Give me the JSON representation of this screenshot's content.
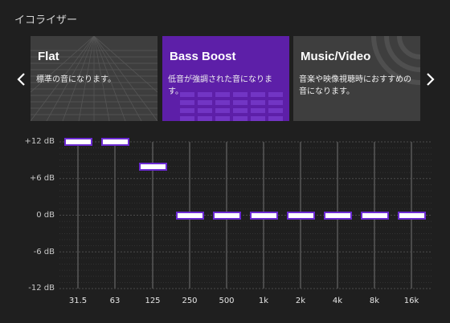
{
  "title": "イコライザー",
  "presets": [
    {
      "title": "Flat",
      "description": "標準の音になります。",
      "selected": false
    },
    {
      "title": "Bass Boost",
      "description": "低音が強調された音になります。",
      "selected": true
    },
    {
      "title": "Music/Video",
      "description": "音楽や映像視聴時におすすめの音になります。",
      "selected": false
    }
  ],
  "db_labels": [
    "+12 dB",
    "+6 dB",
    "0 dB",
    "-6 dB",
    "-12 dB"
  ],
  "db_range": [
    -12,
    12
  ],
  "bands": [
    {
      "freq": "31.5",
      "gain_db": 12
    },
    {
      "freq": "63",
      "gain_db": 12
    },
    {
      "freq": "125",
      "gain_db": 8
    },
    {
      "freq": "250",
      "gain_db": 0
    },
    {
      "freq": "500",
      "gain_db": 0
    },
    {
      "freq": "1k",
      "gain_db": 0
    },
    {
      "freq": "2k",
      "gain_db": 0
    },
    {
      "freq": "4k",
      "gain_db": 0
    },
    {
      "freq": "8k",
      "gain_db": 0
    },
    {
      "freq": "16k",
      "gain_db": 0
    }
  ],
  "colors": {
    "background": "#1f1f1f",
    "card": "#3e3e3e",
    "card_selected": "#5d1fa8",
    "handle_border": "#6b2ad1",
    "slider_track": "#4a4a4a"
  },
  "icons": {
    "left": "chevron-left-icon",
    "right": "chevron-right-icon"
  }
}
